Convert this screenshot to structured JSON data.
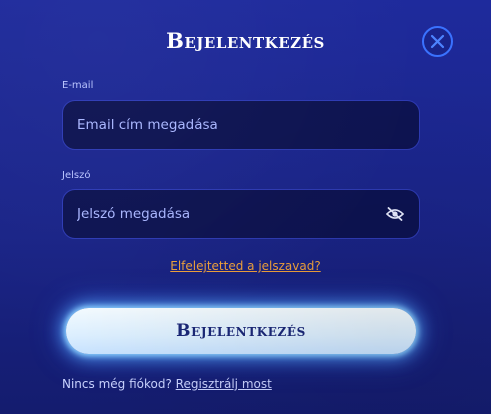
{
  "modal": {
    "title": "Bejelentkezés",
    "close_icon": "close-icon"
  },
  "email": {
    "label": "E-mail",
    "placeholder": "Email cím megadása",
    "value": ""
  },
  "password": {
    "label": "Jelszó",
    "placeholder": "Jelszó megadása",
    "value": "",
    "toggle_icon": "eye-slash-icon"
  },
  "forgot_password": "Elfelejtetted a jelszavad?",
  "login_button": "Bejelentkezés",
  "signup": {
    "prompt": "Nincs még fiókod?",
    "link": "Regisztrálj most"
  },
  "colors": {
    "background": "#1e2a9c",
    "input_background": "#0d1352",
    "accent_link": "#f2a33c",
    "close_ring": "#3a72ff",
    "button_glow": "#8fd3ff"
  }
}
